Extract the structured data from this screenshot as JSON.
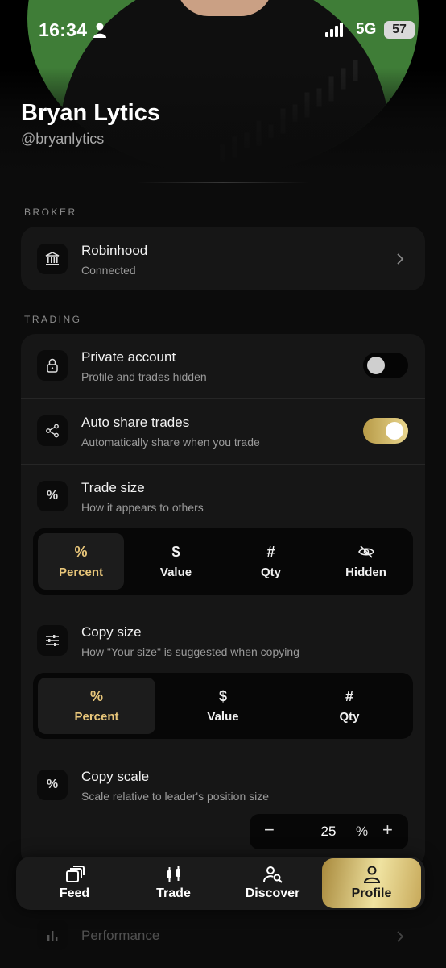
{
  "status_bar": {
    "time": "16:34",
    "network": "5G",
    "battery": "57"
  },
  "profile": {
    "name": "Bryan Lytics",
    "handle": "@bryanlytics"
  },
  "broker_section": {
    "label": "BROKER",
    "broker": {
      "title": "Robinhood",
      "subtitle": "Connected",
      "icon": "bank-icon"
    }
  },
  "trading_section": {
    "label": "TRADING",
    "private_account": {
      "title": "Private account",
      "subtitle": "Profile and trades hidden",
      "enabled": false,
      "icon": "lock-icon"
    },
    "auto_share": {
      "title": "Auto share trades",
      "subtitle": "Automatically share when you trade",
      "enabled": true,
      "icon": "share-icon"
    },
    "trade_size": {
      "title": "Trade size",
      "subtitle": "How it appears to others",
      "icon": "percent-icon",
      "options": [
        {
          "symbol": "%",
          "label": "Percent",
          "active": true
        },
        {
          "symbol": "$",
          "label": "Value",
          "active": false
        },
        {
          "symbol": "#",
          "label": "Qty",
          "active": false
        },
        {
          "symbol": "eye-off-icon",
          "label": "Hidden",
          "active": false
        }
      ]
    },
    "copy_size": {
      "title": "Copy size",
      "subtitle": "How \"Your size\" is suggested when copying",
      "icon": "sliders-icon",
      "options": [
        {
          "symbol": "%",
          "label": "Percent",
          "active": true
        },
        {
          "symbol": "$",
          "label": "Value",
          "active": false
        },
        {
          "symbol": "#",
          "label": "Qty",
          "active": false
        }
      ]
    },
    "copy_scale": {
      "title": "Copy scale",
      "subtitle": "Scale relative to leader's position size",
      "icon": "percent-icon",
      "value": "25",
      "unit": "%",
      "minus": "−",
      "plus": "+"
    }
  },
  "bottom_nav": [
    {
      "label": "Feed",
      "icon": "feed-icon",
      "active": false
    },
    {
      "label": "Trade",
      "icon": "candles-icon",
      "active": false
    },
    {
      "label": "Discover",
      "icon": "discover-icon",
      "active": false
    },
    {
      "label": "Profile",
      "icon": "person-icon",
      "active": true
    }
  ],
  "performance": {
    "title": "Performance",
    "icon": "bar-chart-icon"
  },
  "colors": {
    "accent_gold": "#e8c67a",
    "card": "#161616",
    "background": "#0c0c0c"
  }
}
